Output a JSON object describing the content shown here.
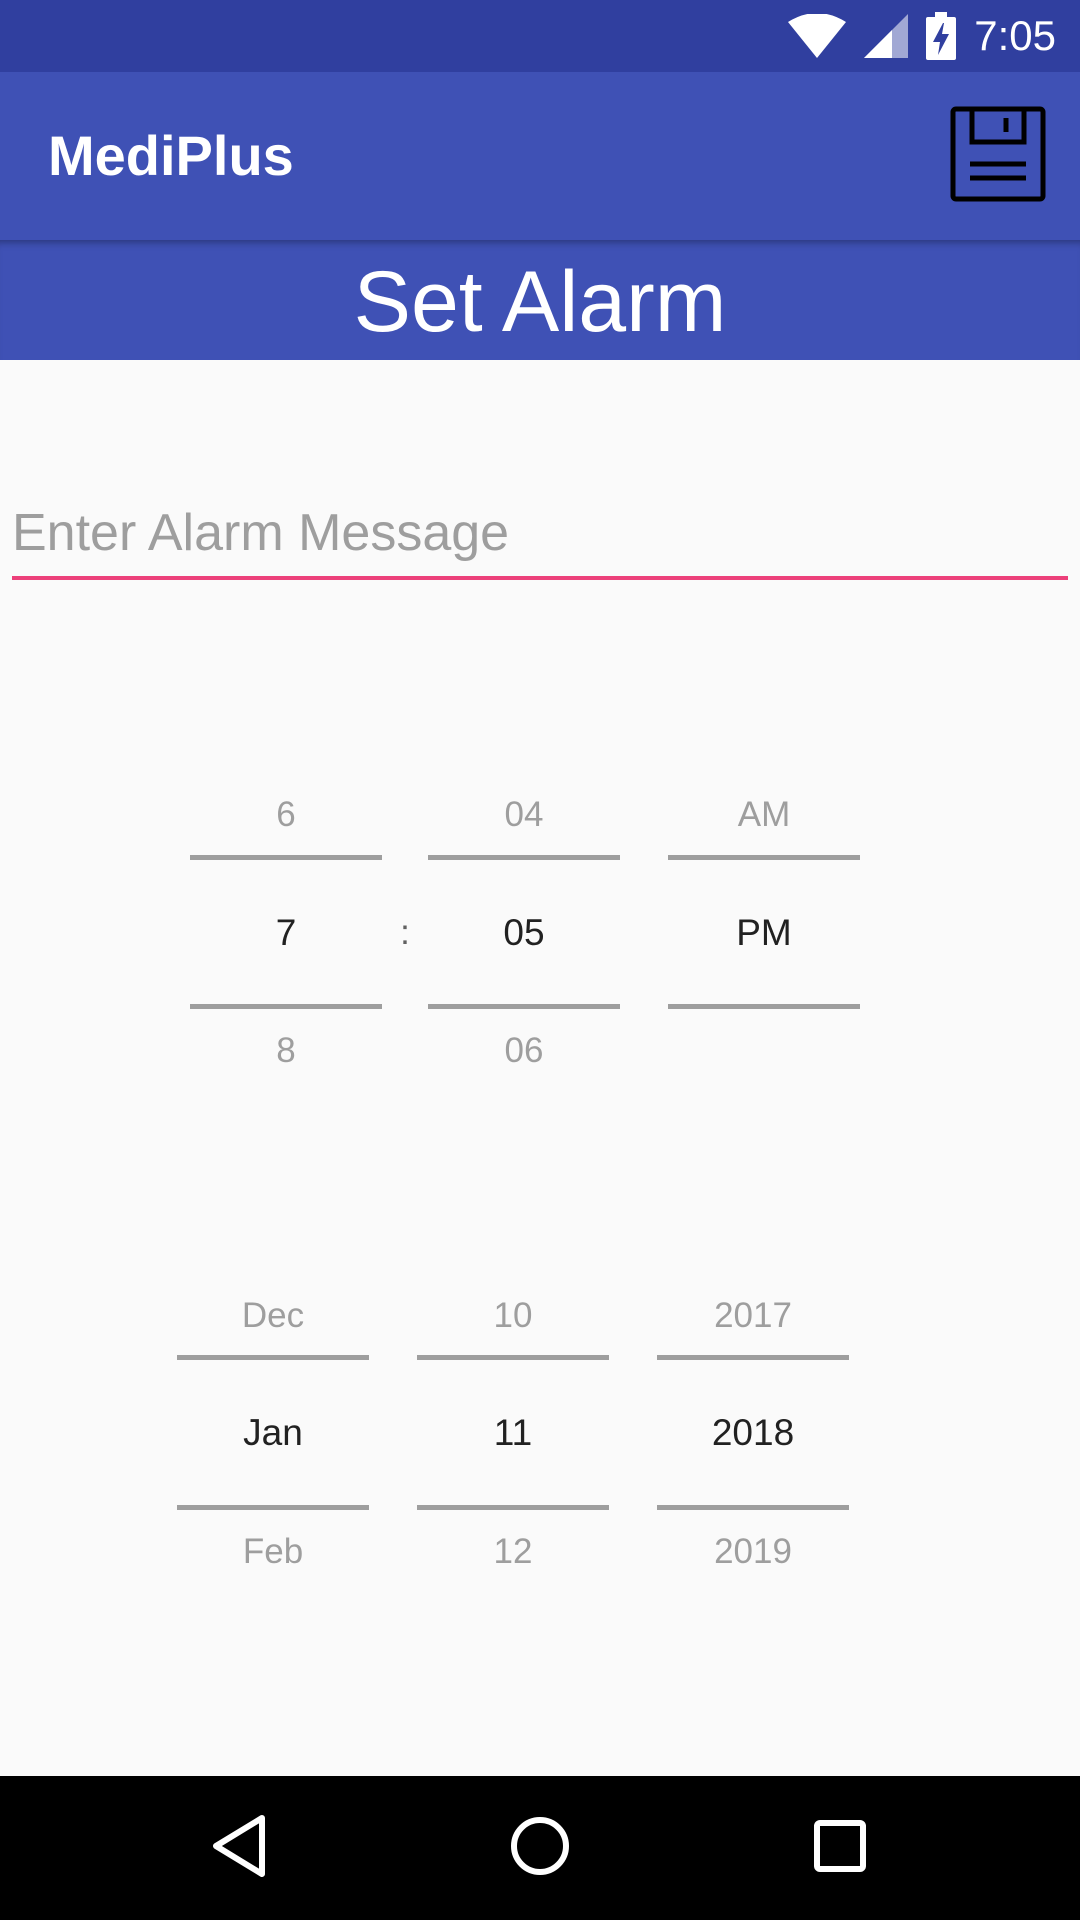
{
  "status_bar": {
    "time": "7:05",
    "icons": [
      "wifi-icon",
      "signal-icon",
      "battery-charging-icon"
    ]
  },
  "app_bar": {
    "title": "MediPlus",
    "actions": [
      "save-icon"
    ]
  },
  "header": {
    "title": "Set Alarm"
  },
  "message_field": {
    "placeholder": "Enter Alarm Message",
    "value": ""
  },
  "time_picker": {
    "separator": ":",
    "hour": {
      "prev": "6",
      "selected": "7",
      "next": "8"
    },
    "minute": {
      "prev": "04",
      "selected": "05",
      "next": "06"
    },
    "ampm": {
      "prev": "AM",
      "selected": "PM",
      "next": ""
    }
  },
  "date_picker": {
    "month": {
      "prev": "Dec",
      "selected": "Jan",
      "next": "Feb"
    },
    "day": {
      "prev": "10",
      "selected": "11",
      "next": "12"
    },
    "year": {
      "prev": "2017",
      "selected": "2018",
      "next": "2019"
    }
  },
  "nav_bar": {
    "buttons": [
      "back-icon",
      "home-icon",
      "recents-icon"
    ]
  },
  "colors": {
    "status_bar": "#303f9f",
    "primary": "#3f51b5",
    "accent": "#ec407a",
    "background": "#fafafa"
  }
}
